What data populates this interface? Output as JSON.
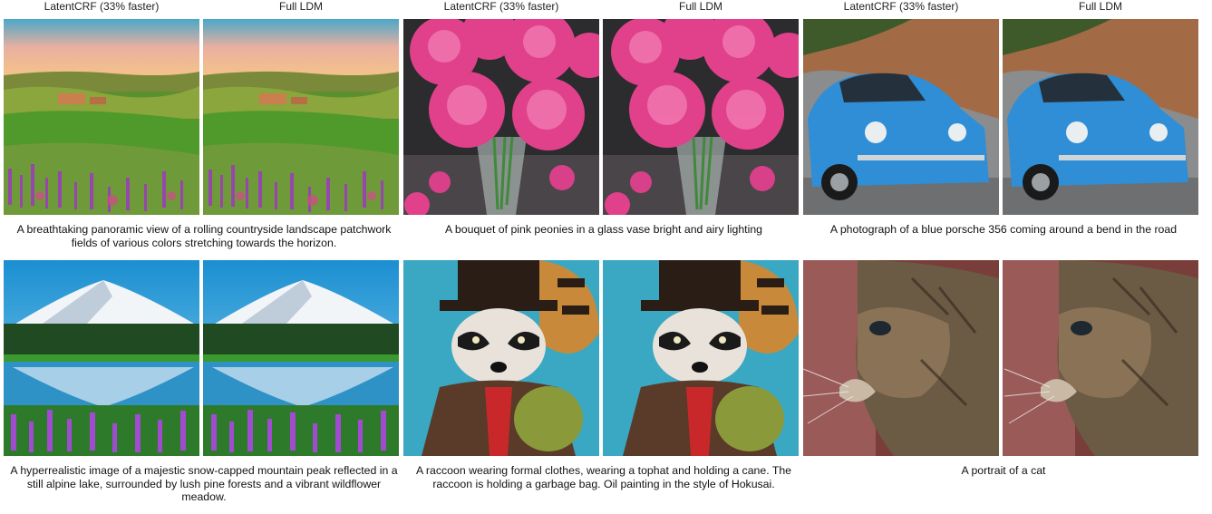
{
  "column_labels": [
    "LatentCRF (33% faster)",
    "Full LDM",
    "LatentCRF (33% faster)",
    "Full LDM",
    "LatentCRF (33% faster)",
    "Full LDM"
  ],
  "captions": {
    "countryside": "A breathtaking panoramic view of a rolling countryside landscape patchwork fields of various colors stretching towards the horizon.",
    "peonies": "A bouquet of pink peonies in a glass vase bright and airy lighting",
    "porsche": "A photograph of a blue porsche 356 coming around a bend in the road",
    "mountain": "A hyperrealistic image of a majestic snow-capped mountain peak reflected in a still alpine lake, surrounded by lush pine forests and a vibrant wildflower meadow.",
    "raccoon": "A raccoon wearing formal clothes, wearing a tophat and holding a cane. The raccoon is holding a garbage bag. Oil painting in the style of Hokusai.",
    "cat": "A portrait of a cat"
  }
}
